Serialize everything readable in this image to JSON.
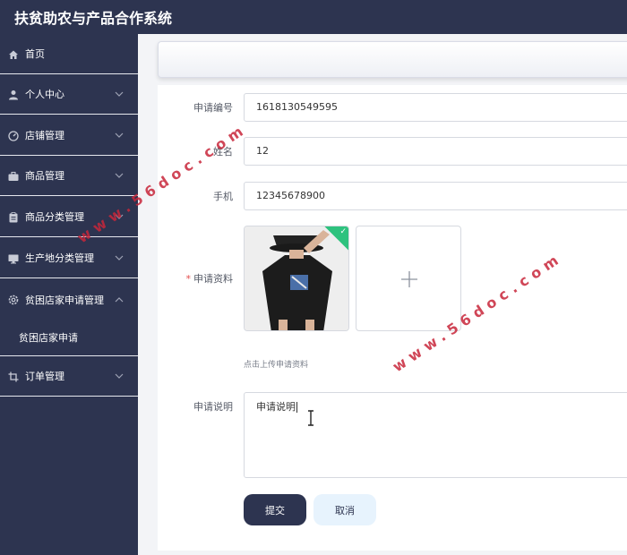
{
  "app": {
    "title": "扶贫助农与产品合作系统"
  },
  "sidebar": {
    "items": [
      {
        "label": "首页",
        "icon": "home-icon",
        "has_chevron": false
      },
      {
        "label": "个人中心",
        "icon": "user-icon",
        "has_chevron": true
      },
      {
        "label": "店铺管理",
        "icon": "dashboard-icon",
        "has_chevron": true
      },
      {
        "label": "商品管理",
        "icon": "briefcase-icon",
        "has_chevron": true
      },
      {
        "label": "商品分类管理",
        "icon": "clipboard-icon",
        "has_chevron": true
      },
      {
        "label": "生产地分类管理",
        "icon": "monitor-icon",
        "has_chevron": true
      },
      {
        "label": "贫困店家申请管理",
        "icon": "gear-icon",
        "has_chevron": true,
        "expanded": true
      },
      {
        "label": "贫困店家申请",
        "submenu": true
      },
      {
        "label": "订单管理",
        "icon": "crop-icon",
        "has_chevron": true
      }
    ]
  },
  "form": {
    "fields": {
      "app_no": {
        "label": "申请编号",
        "value": "1618130549595"
      },
      "name": {
        "label": "姓名",
        "value": "12"
      },
      "phone": {
        "label": "手机",
        "value": "12345678900"
      },
      "materials": {
        "label": "申请资料",
        "required": true,
        "hint": "点击上传申请资料"
      },
      "description": {
        "label": "申请说明",
        "value": "申请说明"
      }
    },
    "submit_label": "提交",
    "cancel_label": "取消"
  },
  "watermarks": [
    "www.56doc.com",
    "www.56doc.com"
  ],
  "colors": {
    "navy": "#2d3450",
    "accent_green": "#2ec27e",
    "required_red": "#e34c4c",
    "cancel_bg": "#e7f3fd",
    "watermark": "#c8263a"
  }
}
